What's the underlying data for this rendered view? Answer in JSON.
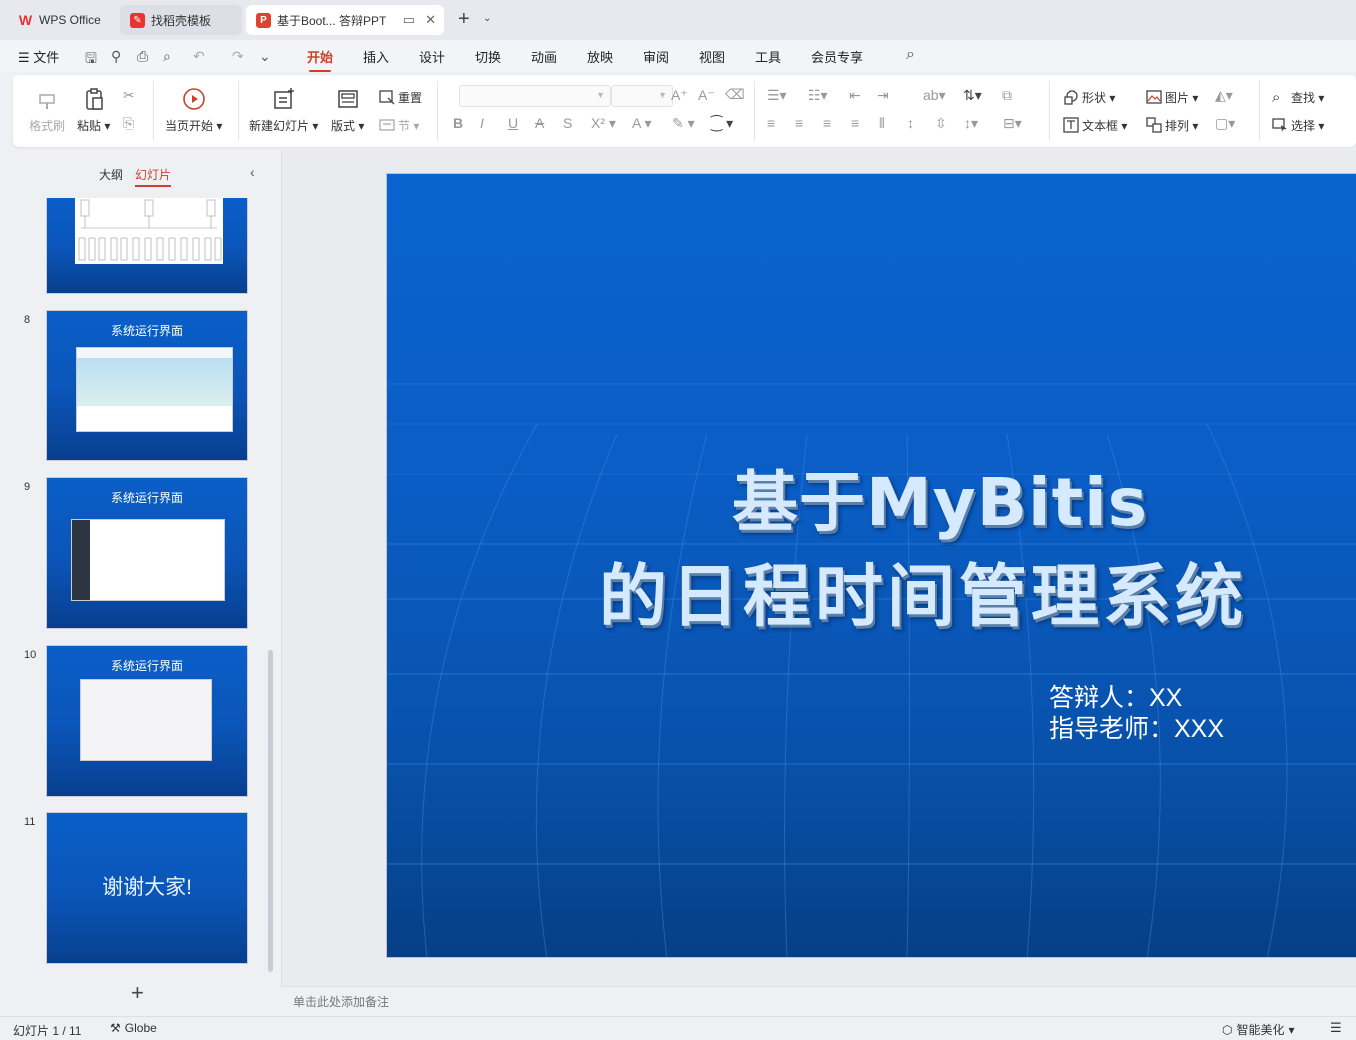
{
  "tabs": {
    "wps": "WPS Office",
    "docer": "找稻壳模板",
    "document": "基于Boot... 答辩PPT"
  },
  "menu": {
    "file": "文件",
    "items": [
      "开始",
      "插入",
      "设计",
      "切换",
      "动画",
      "放映",
      "审阅",
      "视图",
      "工具",
      "会员专享"
    ],
    "active": "开始"
  },
  "ribbon": {
    "format_painter": "格式刷",
    "paste": "粘贴",
    "from_current": "当页开始",
    "new_slide": "新建幻灯片",
    "layout": "版式",
    "reset": "重置",
    "section": "节",
    "shape": "形状",
    "picture": "图片",
    "textbox": "文本框",
    "arrange": "排列",
    "find": "查找",
    "select": "选择"
  },
  "left_panel": {
    "outline_tab": "大纲",
    "slides_tab": "幻灯片",
    "slides": [
      {
        "num": "8",
        "title": "系统运行界面"
      },
      {
        "num": "9",
        "title": "系统运行界面"
      },
      {
        "num": "10",
        "title": "系统运行界面"
      },
      {
        "num": "11",
        "title": "谢谢大家!"
      }
    ]
  },
  "slide": {
    "title_line1": "基于MyBitis",
    "title_line2": "的日程时间管理系统",
    "defender": "答辩人：XX",
    "advisor": "指导老师：XXX"
  },
  "notes_placeholder": "单击此处添加备注",
  "status": {
    "slide_count": "幻灯片 1 / 11",
    "theme": "Globe",
    "beautify": "智能美化"
  },
  "colors": {
    "accent": "#c8432a",
    "slide_blue": "#0a5dc4"
  }
}
